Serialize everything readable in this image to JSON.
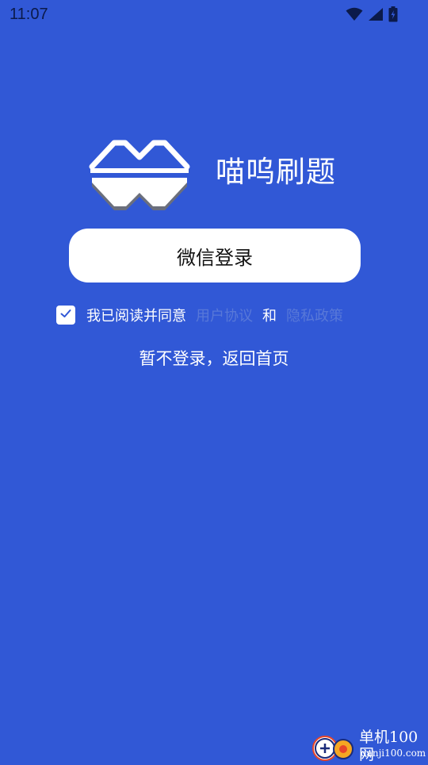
{
  "status_bar": {
    "time": "11:07",
    "icons": [
      "wifi-icon",
      "cellular-signal-icon",
      "battery-charging-icon"
    ]
  },
  "app": {
    "name": "喵呜刷题",
    "logo_icon": "mountain-logo-icon"
  },
  "login": {
    "wechat_button_label": "微信登录"
  },
  "agreement": {
    "checked": true,
    "prefix": "我已阅读并同意",
    "user_agreement": "用户协议",
    "and": "和",
    "privacy_policy": "隐私政策"
  },
  "skip": {
    "label": "暂不登录，返回首页"
  },
  "watermark": {
    "title": "单机100网",
    "url": "danji100.com"
  },
  "colors": {
    "background": "#3158d6",
    "link": "#5878d8",
    "button_bg": "#ffffff",
    "status_text": "#0b1a4a"
  }
}
